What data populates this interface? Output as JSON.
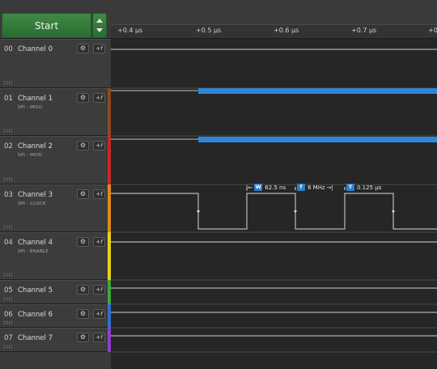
{
  "start_button": {
    "label": "Start"
  },
  "timeline": {
    "ticks": [
      "+0.4 µs",
      "+0.5 µs",
      "+0.6 µs",
      "+0.7 µs",
      "+0"
    ]
  },
  "channels": [
    {
      "num": "00",
      "name": "Channel 0",
      "sub": "",
      "color": "#3c3c3c"
    },
    {
      "num": "01",
      "name": "Channel 1",
      "sub": "SPI - MISO",
      "color": "#8a4a1e"
    },
    {
      "num": "02",
      "name": "Channel 2",
      "sub": "SPI - MOSI",
      "color": "#c62828"
    },
    {
      "num": "03",
      "name": "Channel 3",
      "sub": "SPI - CLOCK",
      "color": "#e08a1a"
    },
    {
      "num": "04",
      "name": "Channel 4",
      "sub": "SPI - ENABLE",
      "color": "#e8d21a"
    },
    {
      "num": "05",
      "name": "Channel 5",
      "sub": "",
      "color": "#3aa83a"
    },
    {
      "num": "06",
      "name": "Channel 6",
      "sub": "",
      "color": "#2f6fd0"
    },
    {
      "num": "07",
      "name": "Channel 7",
      "sub": "",
      "color": "#8e3fc9"
    }
  ],
  "measurements": {
    "width_badge": "W",
    "width": "62.5 ns",
    "freq_badge": "f",
    "freq": "8 MHz",
    "period_badge": "T",
    "period": "0.125 µs"
  },
  "icons": {
    "settings": "gear-icon",
    "function": "fx-icon"
  },
  "colors": {
    "signal_blue": "#2f86d8",
    "accent_green": "#3a8a42"
  }
}
